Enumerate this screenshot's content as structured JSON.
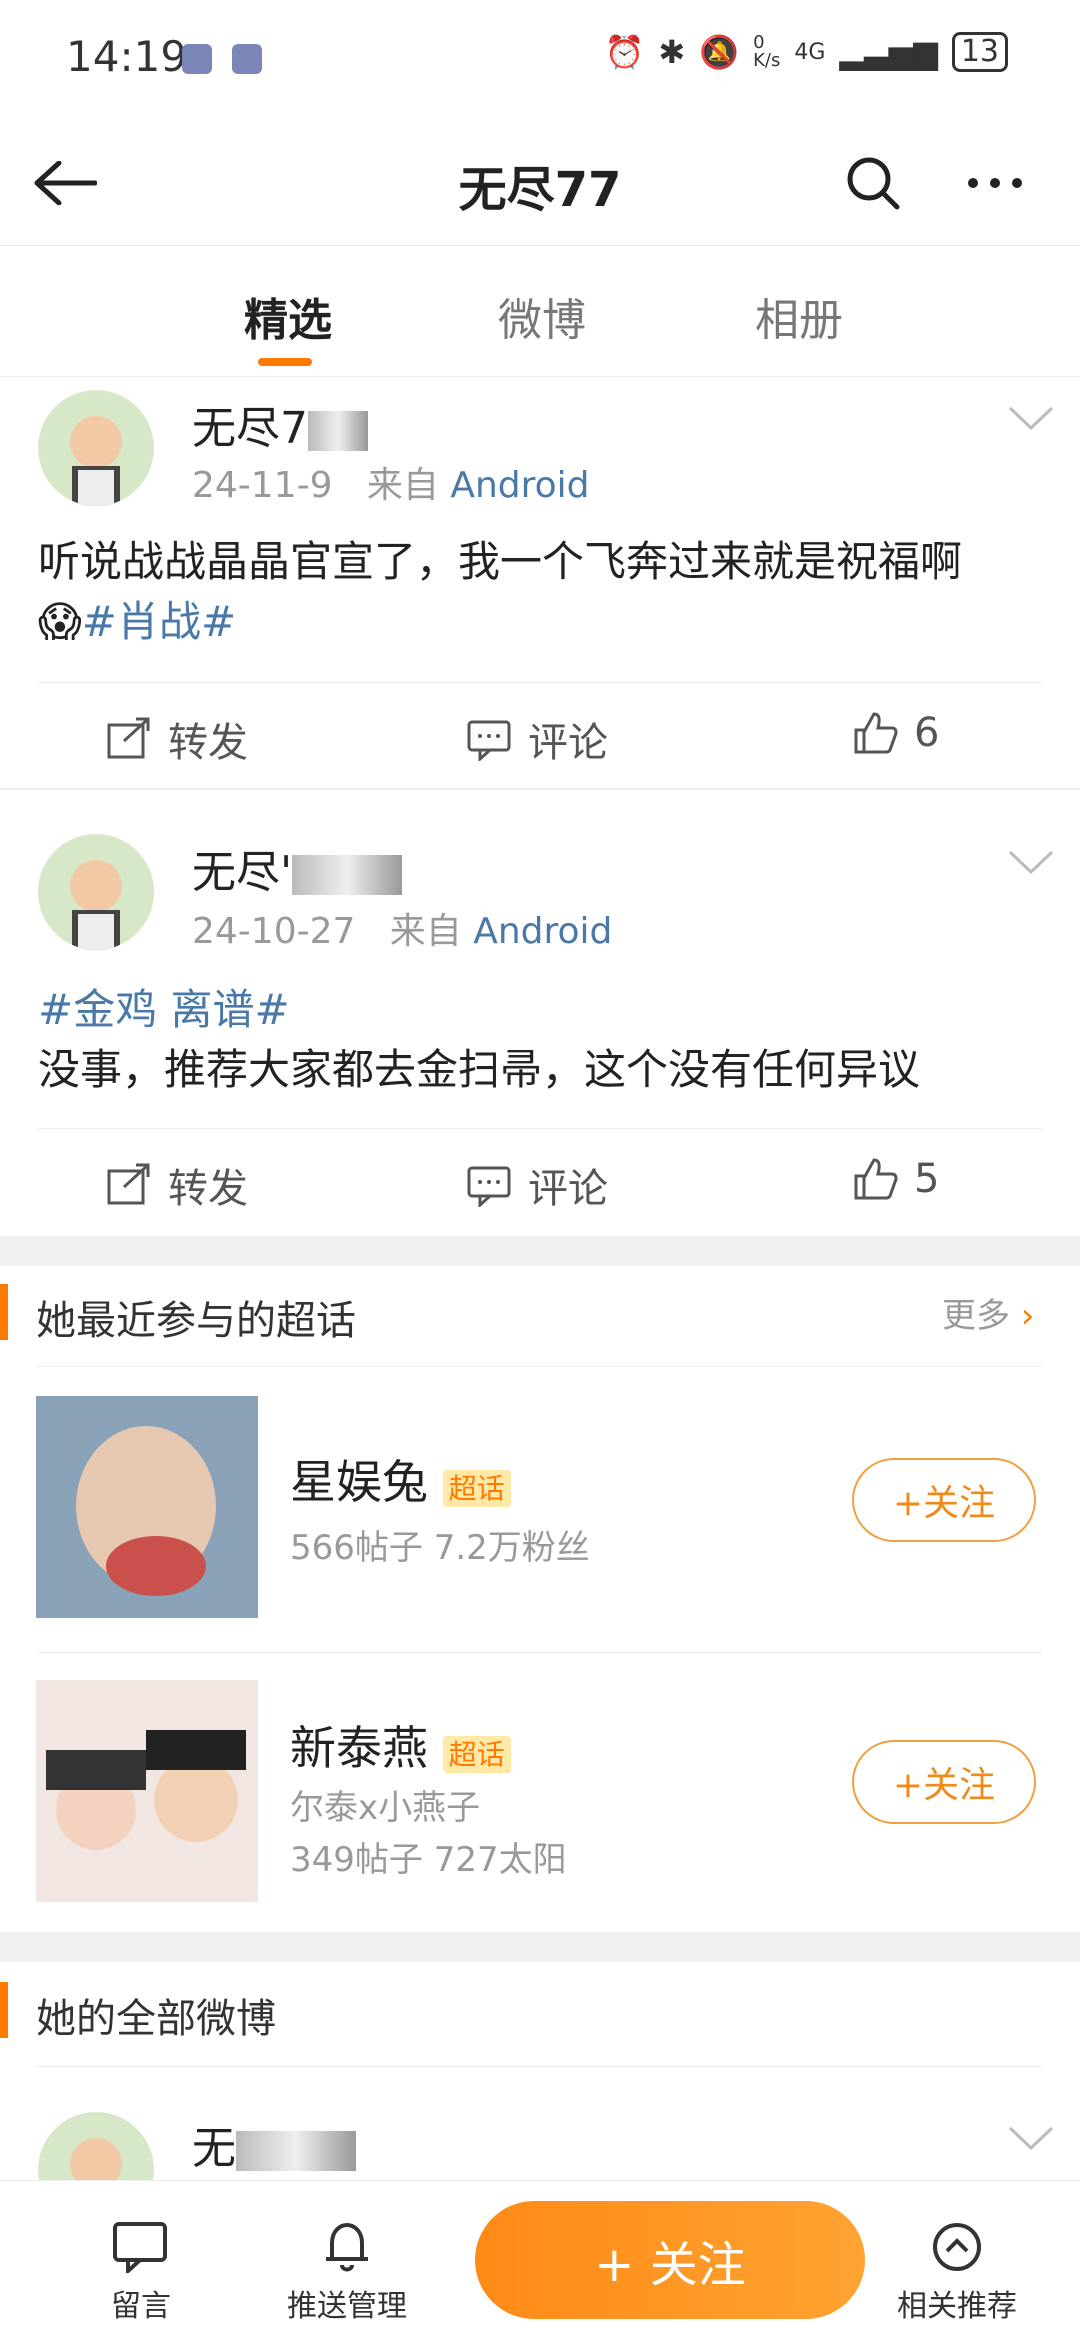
{
  "status": {
    "time": "14:19",
    "network": "0\nK/s",
    "signal": "4G",
    "battery": "13"
  },
  "nav": {
    "title": "无尽77"
  },
  "tabs": [
    {
      "label": "精选",
      "active": true
    },
    {
      "label": "微博",
      "active": false
    },
    {
      "label": "相册",
      "active": false
    }
  ],
  "posts": [
    {
      "name": "无尽7",
      "date": "24-11-9",
      "from": "来自",
      "source": "Android",
      "text": "听说战战晶晶官宣了，我一个飞奔过来就是祝福啊",
      "hashtags": [
        "#肖战#"
      ],
      "actions": {
        "repost": "转发",
        "comment": "评论",
        "likes": "6"
      }
    },
    {
      "name": "无尽'",
      "date": "24-10-27",
      "from": "来自",
      "source": "Android",
      "hashtags": [
        "#金鸡 离谱#"
      ],
      "text": "没事，推荐大家都去金扫帚，这个没有任何异议",
      "actions": {
        "repost": "转发",
        "comment": "评论",
        "likes": "5"
      }
    }
  ],
  "supertopics": {
    "title": "她最近参与的超话",
    "more": "更多",
    "items": [
      {
        "name": "星娱兔",
        "badge": "超话",
        "line1": "566帖子 7.2万粉丝",
        "line2": "",
        "follow": "+关注"
      },
      {
        "name": "新泰燕",
        "badge": "超话",
        "line1": "尔泰x小燕子",
        "line2": "349帖子 727太阳",
        "follow": "+关注"
      }
    ]
  },
  "allposts": {
    "title": "她的全部微博",
    "preview_name": "无"
  },
  "bottombar": {
    "message": "留言",
    "push": "推送管理",
    "follow": "+ 关注",
    "related": "相关推荐"
  }
}
